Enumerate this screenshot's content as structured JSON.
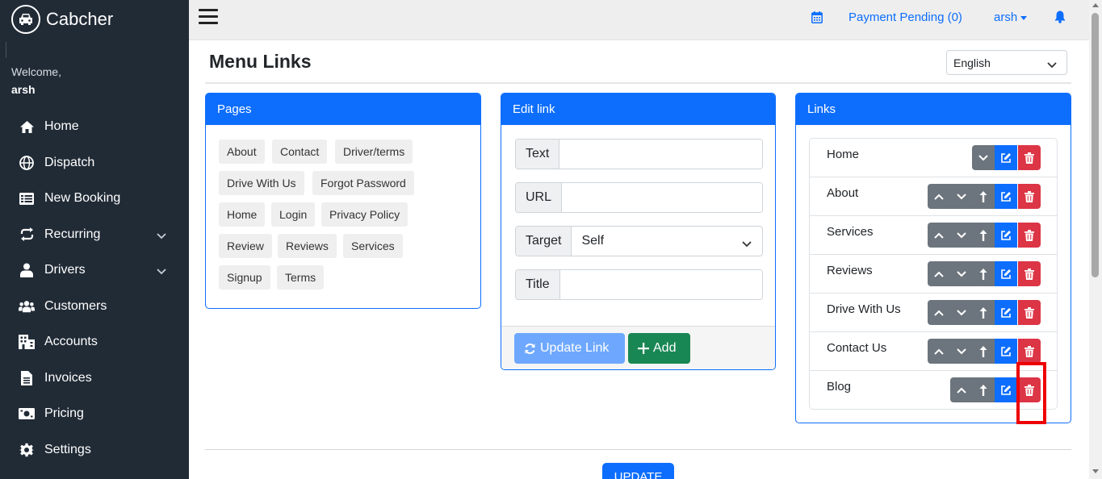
{
  "brand": {
    "name": "Cabcher",
    "logo_icon": "car-icon"
  },
  "sidebar": {
    "welcome": "Welcome,",
    "username": "arsh",
    "items": [
      {
        "label": "Home",
        "icon": "home-icon"
      },
      {
        "label": "Dispatch",
        "icon": "globe-icon"
      },
      {
        "label": "New Booking",
        "icon": "list-icon"
      },
      {
        "label": "Recurring",
        "icon": "repeat-icon",
        "expandable": true
      },
      {
        "label": "Drivers",
        "icon": "driver-icon",
        "expandable": true
      },
      {
        "label": "Customers",
        "icon": "users-icon"
      },
      {
        "label": "Accounts",
        "icon": "building-icon"
      },
      {
        "label": "Invoices",
        "icon": "invoice-icon"
      },
      {
        "label": "Pricing",
        "icon": "money-icon"
      },
      {
        "label": "Settings",
        "icon": "gear-icon"
      }
    ]
  },
  "topbar": {
    "payment_pending": "Payment Pending (0)",
    "user_menu": "arsh"
  },
  "header": {
    "title": "Menu Links",
    "language": "English"
  },
  "pages_panel": {
    "title": "Pages",
    "tags": [
      "About",
      "Contact",
      "Driver/terms",
      "Drive With Us",
      "Forgot Password",
      "Home",
      "Login",
      "Privacy Policy",
      "Review",
      "Reviews",
      "Services",
      "Signup",
      "Terms"
    ]
  },
  "edit_panel": {
    "title": "Edit link",
    "fields": {
      "text_label": "Text",
      "text_value": "",
      "url_label": "URL",
      "url_value": "",
      "target_label": "Target",
      "target_value": "Self",
      "title_label": "Title",
      "title_value": ""
    },
    "update_link_label": "Update Link",
    "add_label": "Add"
  },
  "links_panel": {
    "title": "Links",
    "items": [
      "Home",
      "About",
      "Services",
      "Reviews",
      "Drive With Us",
      "Contact Us",
      "Blog"
    ]
  },
  "footer": {
    "update_label": "UPDATE"
  },
  "colors": {
    "primary": "#0d6efd",
    "sidebar": "#212b36",
    "danger": "#dc3545",
    "secondary": "#6c757d",
    "success": "#198754"
  }
}
